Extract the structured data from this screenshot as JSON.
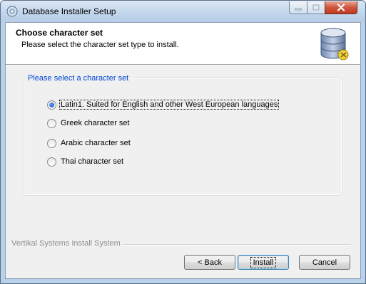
{
  "window": {
    "title": "Database Installer Setup",
    "icon": "installer-disc-icon",
    "controls": [
      "minimize-icon",
      "maximize-icon",
      "close-icon"
    ]
  },
  "header": {
    "title": "Choose character set",
    "subtitle": "Please select the character set type to install.",
    "icon": "database-icon"
  },
  "group": {
    "legend": "Please select a character set",
    "options": [
      {
        "label": "Latin1. Suited for English and other West European languages",
        "selected": true
      },
      {
        "label": "Greek character set",
        "selected": false
      },
      {
        "label": "Arabic character set",
        "selected": false
      },
      {
        "label": "Thai character set",
        "selected": false
      }
    ]
  },
  "footer": {
    "branding": "Vertikal Systems Install System",
    "back_label": "< Back",
    "install_label": "Install",
    "cancel_label": "Cancel"
  },
  "colors": {
    "legend": "#0046d5",
    "title_bar": "#c2d6ec",
    "close_button": "#c13a20"
  }
}
